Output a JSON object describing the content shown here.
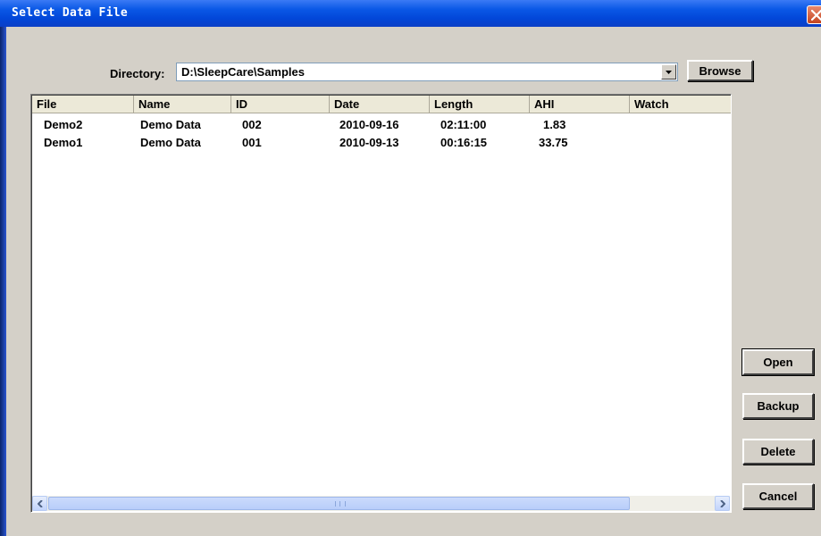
{
  "window": {
    "title": "Select Data File"
  },
  "directory": {
    "label": "Directory:",
    "value": "D:\\SleepCare\\Samples",
    "browse_label": "Browse"
  },
  "table": {
    "columns": [
      "File",
      "Name",
      "ID",
      "Date",
      "Length",
      "AHI",
      "Watch"
    ],
    "rows": [
      [
        "Demo2",
        "Demo Data",
        "002",
        "2010-09-16",
        "02:11:00",
        "1.83",
        ""
      ],
      [
        "Demo1",
        "Demo Data",
        "001",
        "2010-09-13",
        "00:16:15",
        "33.75",
        ""
      ]
    ]
  },
  "buttons": {
    "open": "Open",
    "backup": "Backup",
    "delete": "Delete",
    "cancel": "Cancel"
  },
  "icons": {
    "close": "close-icon",
    "dropdown": "chevron-down-icon",
    "scroll_left": "chevron-left-icon",
    "scroll_right": "chevron-right-icon"
  },
  "colors": {
    "titlebar": "#0a58e6",
    "dialog_bg": "#d4d0c8",
    "close_button": "#d9603b"
  }
}
